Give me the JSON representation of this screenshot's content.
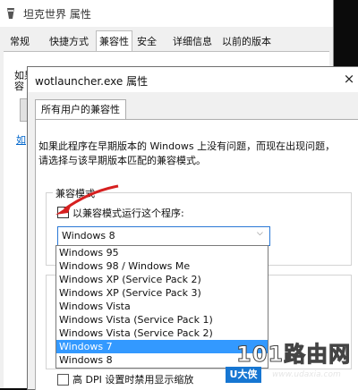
{
  "back_window": {
    "title": "坦克世界 属性",
    "tabs": [
      "常规",
      "快捷方式",
      "兼容性",
      "安全",
      "详细信息",
      "以前的版本"
    ],
    "active_tab": "兼容性",
    "line1": "如果",
    "line2": "容",
    "link_stub": "如"
  },
  "front_dialog": {
    "title": "wotlauncher.exe 属性",
    "close_glyph": "×",
    "tab": "所有用户的兼容性",
    "description_line1": "如果此程序在早期版本的 Windows 上没有问题，而现在出现问题，",
    "description_line2": "请选择与该早期版本匹配的兼容模式。",
    "group_label": "兼容模式",
    "checkbox_label": "以兼容模式运行这个程序:",
    "checkbox_checked": true,
    "checkbox_mark": "✓",
    "select_value": "Windows 8",
    "select_arrow": "⌵",
    "dpi_label": "高 DPI 设置时禁用显示缩放"
  },
  "dropdown": {
    "options": [
      "Windows 95",
      "Windows 98 / Windows Me",
      "Windows XP (Service Pack 2)",
      "Windows XP (Service Pack 3)",
      "Windows Vista",
      "Windows Vista (Service Pack 1)",
      "Windows Vista (Service Pack 2)",
      "Windows 7",
      "Windows 8"
    ],
    "selected": "Windows 7"
  },
  "colors": {
    "selection": "#3399ff",
    "select_border": "#2a78d6",
    "annotation_arrow": "#d62020",
    "watermark_badge": "#1676d2"
  },
  "watermark": {
    "logo": "101路由网",
    "badge": "U大侠",
    "url": "www.udaxia.com"
  }
}
